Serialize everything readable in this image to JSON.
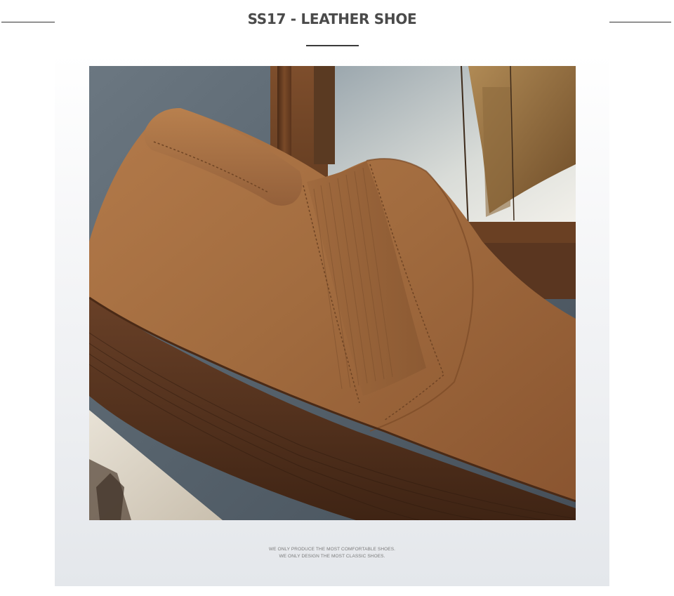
{
  "header": {
    "title": "SS17 - LEATHER SHOE"
  },
  "photo": {
    "subject": "brown-suede-slip-on-ankle-shoe"
  },
  "footer": {
    "line1": "WE ONLY PRODUCE THE MOST COMFORTABLE SHOES.",
    "line2": "WE ONLY DESIGN THE MOST CLASSIC SHOES."
  },
  "colors": {
    "title": "#4a4a4a",
    "suede": "#a26c3f",
    "sole": "#5a3620",
    "frame_wood": "#6a4023",
    "background_slate": "#5e6a74"
  }
}
